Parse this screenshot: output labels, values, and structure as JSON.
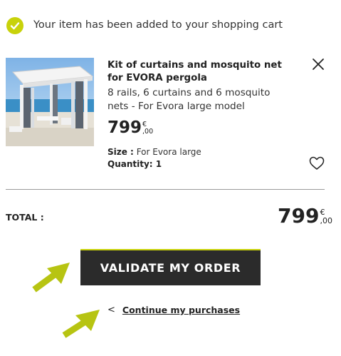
{
  "notification": {
    "text": "Your item has been added to your shopping cart",
    "icon": "check-circle-icon",
    "icon_color": "#c8d20a"
  },
  "product": {
    "title": "Kit of curtains and mosquito net for EVORA pergola",
    "description": "8 rails, 6 curtains and 6 mosquito nets - For Evora large model",
    "price_int": "799",
    "price_currency": "€",
    "price_cents": ",00",
    "size_label": "Size :",
    "size_value": "For Evora large",
    "quantity_label": "Quantity: 1"
  },
  "total": {
    "label": "TOTAL :",
    "price_int": "799",
    "price_currency": "€",
    "price_cents": ",00"
  },
  "actions": {
    "validate_label": "VALIDATE MY ORDER",
    "continue_label": "Continue my purchases",
    "continue_chevron": "<"
  },
  "colors": {
    "accent": "#c8d20a",
    "button_bg": "#2b2b2b",
    "divider": "#9a9a9a"
  }
}
